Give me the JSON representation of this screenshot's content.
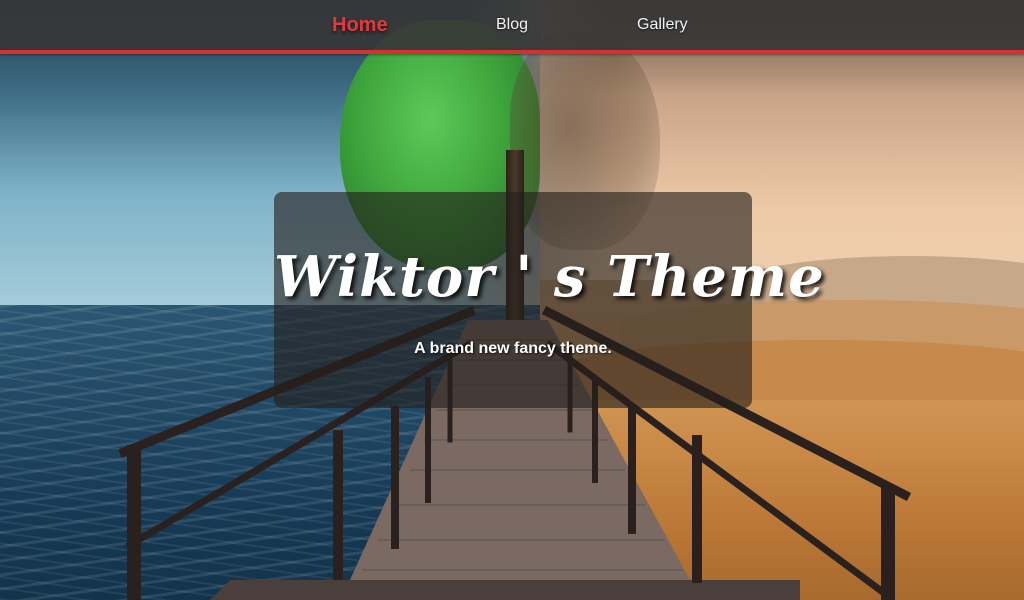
{
  "nav": {
    "items": [
      {
        "label": "Home",
        "active": true
      },
      {
        "label": "Blog",
        "active": false
      },
      {
        "label": "Gallery",
        "active": false
      }
    ],
    "accent_color": "#e03a3a",
    "bar_color": "#373737"
  },
  "hero": {
    "title": "Wiktor ' s Theme",
    "subtitle": "A brand new fancy theme."
  },
  "background": {
    "icon": "landscape-sea-desert-pier-image"
  }
}
